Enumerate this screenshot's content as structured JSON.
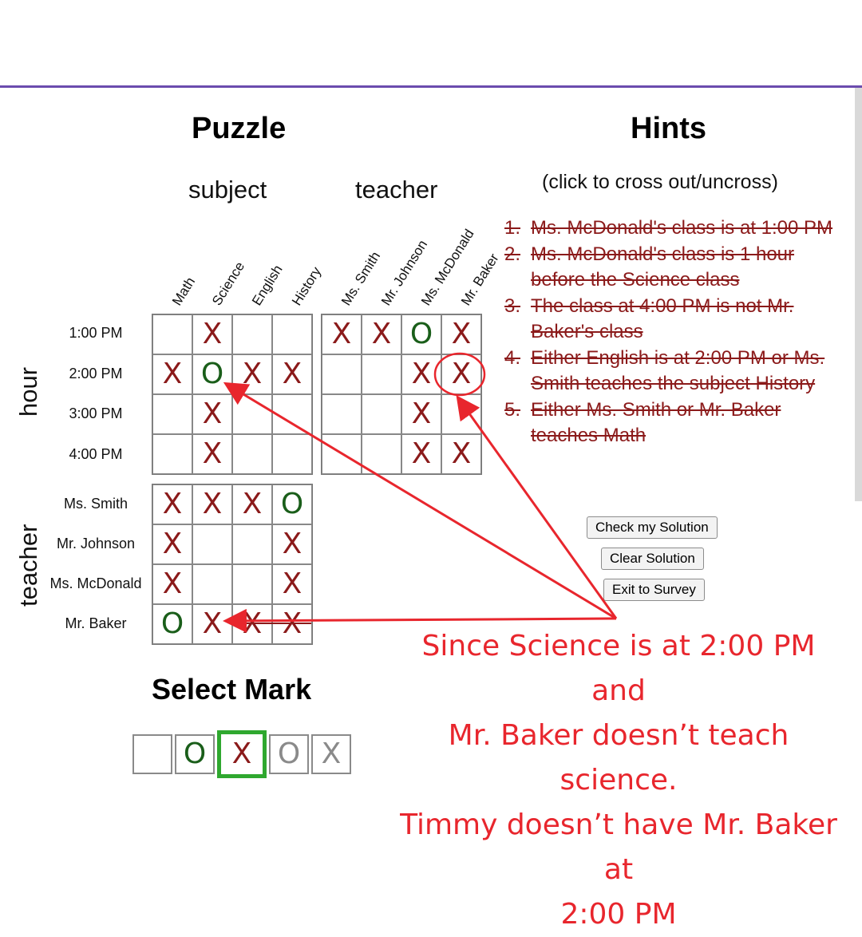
{
  "puzzle": {
    "title": "Puzzle",
    "subject_group": "subject",
    "teacher_group": "teacher",
    "hour_side": "hour",
    "teacher_side": "teacher",
    "subject_cols": [
      "Math",
      "Science",
      "English",
      "History"
    ],
    "teacher_cols": [
      "Ms. Smith",
      "Mr. Johnson",
      "Ms. McDonald",
      "Mr. Baker"
    ],
    "hour_rows": [
      "1:00 PM",
      "2:00 PM",
      "3:00 PM",
      "4:00 PM"
    ],
    "teacher_rows": [
      "Ms. Smith",
      "Mr. Johnson",
      "Ms. McDonald",
      "Mr. Baker"
    ],
    "grid_hour_subject": [
      [
        "",
        "X",
        "",
        ""
      ],
      [
        "X",
        "O",
        "X",
        "X"
      ],
      [
        "",
        "X",
        "",
        ""
      ],
      [
        "",
        "X",
        "",
        ""
      ]
    ],
    "grid_hour_teacher": [
      [
        "X",
        "X",
        "O",
        "X"
      ],
      [
        "",
        "",
        "X",
        "X"
      ],
      [
        "",
        "",
        "X",
        ""
      ],
      [
        "",
        "",
        "X",
        "X"
      ]
    ],
    "grid_teacher_subject": [
      [
        "X",
        "X",
        "X",
        "O"
      ],
      [
        "X",
        "",
        "",
        "X"
      ],
      [
        "X",
        "",
        "",
        "X"
      ],
      [
        "O",
        "X",
        "X",
        "X"
      ]
    ]
  },
  "hints": {
    "title": "Hints",
    "subtitle": "(click to cross out/uncross)",
    "items": [
      {
        "num": "1.",
        "text": "Ms. McDonald's class is at 1:00 PM"
      },
      {
        "num": "2.",
        "text": "Ms. McDonald's class is 1 hour before the Science class"
      },
      {
        "num": "3.",
        "text": "The class at 4:00 PM is not Mr. Baker's class"
      },
      {
        "num": "4.",
        "text": "Either English is at 2:00 PM or Ms. Smith teaches the subject History"
      },
      {
        "num": "5.",
        "text": "Either Ms. Smith or Mr. Baker teaches Math"
      }
    ]
  },
  "buttons": {
    "check": "Check my Solution",
    "clear": "Clear Solution",
    "exit": "Exit to Survey"
  },
  "select_mark": {
    "title": "Select Mark",
    "options": [
      "",
      "O",
      "X",
      "O",
      "X"
    ],
    "selected_index": 2
  },
  "annotation": {
    "line1": "Since Science is at 2:00 PM and",
    "line2": "Mr. Baker doesn’t teach science.",
    "line3": "Timmy doesn’t have Mr. Baker at",
    "line4": "2:00 PM"
  },
  "colors": {
    "x_mark": "#8b1a1a",
    "o_mark": "#1a5e1a",
    "annotation": "#e8262d",
    "selected_border": "#2fa82f",
    "top_rule": "#6b4cae"
  }
}
